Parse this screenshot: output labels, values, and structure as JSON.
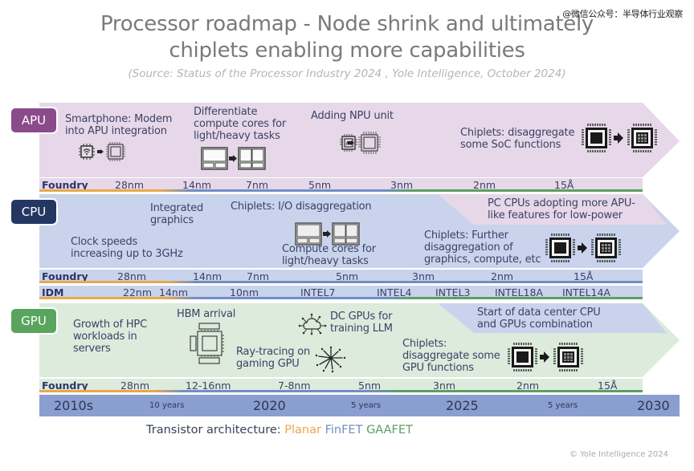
{
  "header": {
    "title_line1": "Processor roadmap - Node shrink and ultimately",
    "title_line2": "chiplets enabling more capabilities",
    "subtitle": "(Source: Status of the Processor Industry 2024 , Yole Intelligence, October 2024)",
    "watermark": "@微信公众号：半导体行业观察"
  },
  "colors": {
    "apu": "#8a4b8b",
    "apu_band": "#e6d8e8",
    "cpu": "#243763",
    "cpu_band": "#c9d4ec",
    "gpu": "#5aa55d",
    "gpu_band": "#dcebdc",
    "planar": "#e9a84a",
    "finfet": "#6f8fc4",
    "gaafet": "#5aa060",
    "timeline": "#8a9ecf"
  },
  "apu": {
    "badge": "APU",
    "milestones": [
      "Smartphone: Modem\ninto APU integration",
      "Differentiate\ncompute cores for\nlight/heavy tasks",
      "Adding NPU unit",
      "Chiplets: disaggregate\nsome SoC functions"
    ],
    "foundry_label": "Foundry",
    "foundry_nodes": [
      "28nm",
      "14nm",
      "7nm",
      "5nm",
      "3nm",
      "2nm",
      "15Å"
    ]
  },
  "cpu": {
    "badge": "CPU",
    "milestones": [
      "Integrated\ngraphics",
      "Chiplets: I/O disaggregation",
      "Clock speeds\nincreasing up to 3GHz",
      "Compute cores for\nlight/heavy tasks",
      "Chiplets: Further\ndisaggregation of\ngraphics, compute, etc",
      "PC CPUs adopting more APU-\nlike features for low-power"
    ],
    "foundry_label": "Foundry",
    "foundry_nodes": [
      "28nm",
      "14nm",
      "7nm",
      "5nm",
      "3nm",
      "2nm",
      "15Å"
    ],
    "idm_label": "IDM",
    "idm_nodes": [
      "22nm",
      "14nm",
      "10nm",
      "INTEL7",
      "INTEL4",
      "INTEL3",
      "INTEL18A",
      "INTEL14A"
    ]
  },
  "gpu": {
    "badge": "GPU",
    "milestones": [
      "Growth of HPC\nworkloads in\nservers",
      "HBM arrival",
      "DC GPUs for\ntraining LLM",
      "Ray-tracing on\ngaming GPU",
      "Chiplets:\ndisaggregate some\nGPU functions",
      "Start of data center CPU\nand GPUs combination"
    ],
    "foundry_label": "Foundry",
    "foundry_nodes": [
      "28nm",
      "12-16nm",
      "7-8nm",
      "5nm",
      "3nm",
      "2nm",
      "15Å"
    ]
  },
  "timeline": {
    "years": [
      "2010s",
      "2020",
      "2025",
      "2030"
    ],
    "gaps": [
      "10 years",
      "5 years",
      "5 years"
    ]
  },
  "legend": {
    "prefix": "Transistor architecture:",
    "planar": "Planar",
    "finfet": "FinFET",
    "gaafet": "GAAFET"
  },
  "footer": {
    "copyright": "© Yole Intelligence 2024"
  },
  "icons": [
    "wifi-chip-icon",
    "chip-icon",
    "arrow-right-icon",
    "core-layout-icon",
    "ai-chip-icon",
    "chiplet-icon",
    "hbm-icon",
    "cloud-network-icon",
    "fireworks-icon"
  ]
}
